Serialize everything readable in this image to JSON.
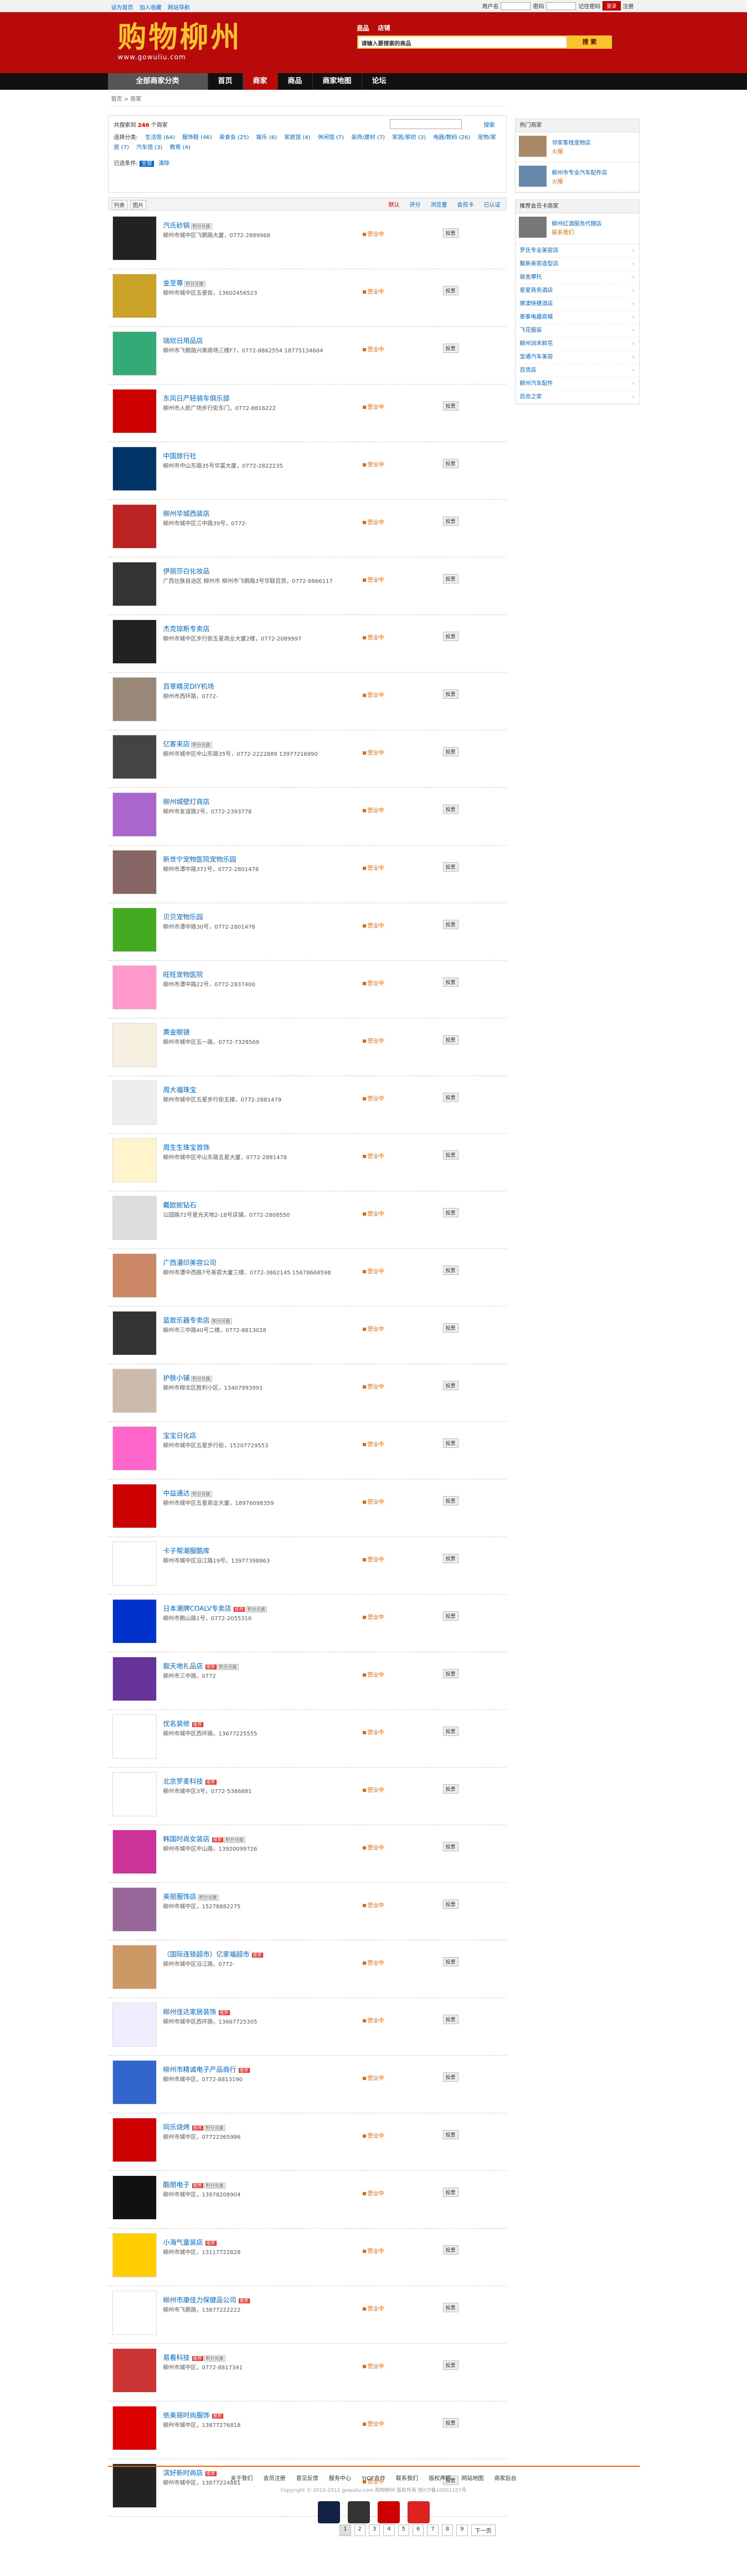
{
  "topbar": {
    "links": [
      "设为首页",
      "加入收藏",
      "网站导航"
    ],
    "user": "用户名",
    "pass": "密码",
    "remember": "记住密码",
    "login": "登录",
    "register": "注册"
  },
  "header": {
    "logo": "购物柳州",
    "url": "www.gowuliu.com",
    "tabs": [
      "商品",
      "店铺"
    ],
    "placeholder": "请输入要搜索的商品",
    "search_btn": "搜 索"
  },
  "nav": {
    "category": "全部商家分类",
    "items": [
      "首页",
      "商家",
      "商品",
      "商家地图",
      "论坛"
    ]
  },
  "crumb": "首页 > 商家",
  "filter": {
    "count_pre": "共搜索到",
    "count": "246",
    "count_post": "个商家",
    "search_btn": "搜索",
    "cat_label": "选择分类:",
    "cats": [
      "生活馆 (64)",
      "服饰鞋 (46)",
      "美食会 (25)",
      "娱乐 (6)",
      "家居馆 (4)",
      "休闲馆 (7)",
      "装饰/建材 (7)",
      "家居/家纺 (3)",
      "电器/数码 (26)",
      "宠物/家居 (7)",
      "汽车馆 (3)",
      "教育 (4)"
    ],
    "sel_label": "已选条件:",
    "sel": "全部",
    "clear": "清除"
  },
  "sortbar": {
    "views": [
      "列表",
      "图片"
    ],
    "sorts": [
      "默认",
      "评分",
      "浏览量",
      "会员卡",
      "已认证"
    ]
  },
  "shops": [
    {
      "name": "汽氏砂锅",
      "addr": "柳州市城中区飞鹅路大厦，0772-2889968",
      "pic": "#222",
      "ok": "营业中",
      "vote": "投票",
      "badge": "",
      "b2": "积分兑换"
    },
    {
      "name": "金至尊",
      "addr": "柳州市城中区五星街，13602456523",
      "pic": "#c9a227",
      "ok": "营业中",
      "vote": "投票",
      "badge": "",
      "b2": "积分兑换"
    },
    {
      "name": "瑞欣日用品店",
      "addr": "柳州市飞鹅路兴南商场三楼F7，0772-8862554 18775134604",
      "pic": "#3a7",
      "ok": "营业中",
      "vote": "投票",
      "badge": "",
      "b2": ""
    },
    {
      "name": "东风日产轻骑车俱乐部",
      "addr": "柳州市人民广场步行街东门，0772-8816222",
      "pic": "#c00",
      "ok": "营业中",
      "vote": "投票",
      "badge": "",
      "b2": ""
    },
    {
      "name": "中国旅行社",
      "addr": "柳州市中山东路35号华富大厦，0772-2822235",
      "pic": "#036",
      "ok": "营业中",
      "vote": "投票",
      "badge": "",
      "b2": ""
    },
    {
      "name": "柳州华城西装店",
      "addr": "柳州市城中区三中路39号，0772-",
      "pic": "#b22",
      "ok": "营业中",
      "vote": "投票",
      "badge": "",
      "b2": ""
    },
    {
      "name": "伊丽莎白化妆品",
      "addr": "广西壮族自治区 柳州市 柳州市飞鹅路3号华联百货，0772-8866117",
      "pic": "#333",
      "ok": "营业中",
      "vote": "投票",
      "badge": "",
      "b2": ""
    },
    {
      "name": "杰克琼斯专卖店",
      "addr": "柳州市城中区步行街五星商业大厦2楼，0772-2089997",
      "pic": "#222",
      "ok": "营业中",
      "vote": "投票",
      "badge": "",
      "b2": ""
    },
    {
      "name": "百草精灵DIY机场",
      "addr": "柳州市西环路，0772-",
      "pic": "#987",
      "ok": "营业中",
      "vote": "投票",
      "badge": "",
      "b2": ""
    },
    {
      "name": "亿客来店",
      "addr": "柳州市城中区中山东路35号，0772-2222889 13977216990",
      "pic": "#444",
      "ok": "营业中",
      "vote": "投票",
      "badge": "",
      "b2": "积分兑换"
    },
    {
      "name": "柳州城壁灯商店",
      "addr": "柳州市友谊路2号，0772-2393778",
      "pic": "#a6c",
      "ok": "营业中",
      "vote": "投票",
      "badge": "",
      "b2": ""
    },
    {
      "name": "新世宁宠物医院宠物乐园",
      "addr": "柳州市潭中路371号，0772-2801478",
      "pic": "#866",
      "ok": "营业中",
      "vote": "投票",
      "badge": "",
      "b2": ""
    },
    {
      "name": "贝贝宠物乐园",
      "addr": "柳州市潭中路30号，0772-2801478",
      "pic": "#4a2",
      "ok": "营业中",
      "vote": "投票",
      "badge": "",
      "b2": ""
    },
    {
      "name": "旺旺宠物医院",
      "addr": "柳州市潭中路22号，0772-2837400",
      "pic": "#f9c",
      "ok": "营业中",
      "vote": "投票",
      "badge": "",
      "b2": ""
    },
    {
      "name": "黄金眼镜",
      "addr": "柳州市城中区五一路，0772-7328569",
      "pic": "#f5f0e0",
      "ok": "营业中",
      "vote": "投票",
      "badge": "",
      "b2": ""
    },
    {
      "name": "周大福珠宝",
      "addr": "柳州市城中区五星步行街五楼，0772-2881479",
      "pic": "#eee",
      "ok": "营业中",
      "vote": "投票",
      "badge": "",
      "b2": ""
    },
    {
      "name": "周生生珠宝首饰",
      "addr": "柳州市城中区中山东路五星大厦，0772-2881478",
      "pic": "#fff4cc",
      "ok": "营业中",
      "vote": "投票",
      "badge": "",
      "b2": ""
    },
    {
      "name": "戴欧妮钻石",
      "addr": "公园路72号星光天地2-18号店铺，0772-2808550",
      "pic": "#ddd",
      "ok": "营业中",
      "vote": "投票",
      "badge": "",
      "b2": ""
    },
    {
      "name": "广西漫印美容公司",
      "addr": "柳州市潭中西路7号美容大厦三楼，0772-3862145 15678668598",
      "pic": "#c86",
      "ok": "营业中",
      "vote": "投票",
      "badge": "",
      "b2": ""
    },
    {
      "name": "蓝歌乐器专卖店",
      "addr": "柳州市三中路40号二楼，0772-8813028",
      "pic": "#333",
      "ok": "营业中",
      "vote": "投票",
      "badge": "",
      "b2": "积分兑换"
    },
    {
      "name": "护肤小铺",
      "addr": "柳州市柳北区胜利小区，13407993991",
      "pic": "#cba",
      "ok": "营业中",
      "vote": "投票",
      "badge": "",
      "b2": "积分兑换"
    },
    {
      "name": "宝宝日化店",
      "addr": "柳州市城中区五星步行街，15207729553",
      "pic": "#f6c",
      "ok": "营业中",
      "vote": "投票",
      "badge": "",
      "b2": ""
    },
    {
      "name": "中益通达",
      "addr": "柳州市城中区五星商业大厦，18976098359",
      "pic": "#c00",
      "ok": "营业中",
      "vote": "投票",
      "badge": "",
      "b2": "积分兑换"
    },
    {
      "name": "卡子帮潮服酷库",
      "addr": "柳州市城中区沿江路19号，13977398863",
      "pic": "#fff",
      "ok": "营业中",
      "vote": "投票",
      "badge": "",
      "b2": ""
    },
    {
      "name": "日本潮牌COALV专卖店",
      "addr": "柳州市鹅山路1号，0772-2055316",
      "pic": "#03c",
      "ok": "营业中",
      "vote": "投票",
      "badge": "推荐",
      "b2": "积分兑换"
    },
    {
      "name": "靓天地礼品店",
      "addr": "柳州市三中路，0772",
      "pic": "#639",
      "ok": "营业中",
      "vote": "投票",
      "badge": "推荐",
      "b2": "积分兑换"
    },
    {
      "name": "优名装修",
      "addr": "柳州市城中区西环路，13677225555",
      "pic": "#fff",
      "ok": "营业中",
      "vote": "投票",
      "badge": "推荐",
      "b2": ""
    },
    {
      "name": "北京罗麦科技",
      "addr": "柳州市城中区3号，0772-5386881",
      "pic": "#fff",
      "ok": "营业中",
      "vote": "投票",
      "badge": "推荐",
      "b2": ""
    },
    {
      "name": "韩国时尚女装店",
      "addr": "柳州市城中区中山路，13920099726",
      "pic": "#c39",
      "ok": "营业中",
      "vote": "投票",
      "badge": "推荐",
      "b2": "积分兑换"
    },
    {
      "name": "美丽服饰店",
      "addr": "柳州市城中区，15278882275",
      "pic": "#969",
      "ok": "营业中",
      "vote": "投票",
      "badge": "",
      "b2": "积分兑换"
    },
    {
      "name": "（国际连锁超市）亿家福超市",
      "addr": "柳州市城中区沿江路，0772-",
      "pic": "#c96",
      "ok": "营业中",
      "vote": "投票",
      "badge": "推荐",
      "b2": ""
    },
    {
      "name": "柳州佳达家居装饰",
      "addr": "柳州市城中区西环路，13667725305",
      "pic": "#eef",
      "ok": "营业中",
      "vote": "投票",
      "badge": "推荐",
      "b2": ""
    },
    {
      "name": "柳州市精诚电子产品商行",
      "addr": "柳州市城中区，0772-8813190",
      "pic": "#36c",
      "ok": "营业中",
      "vote": "投票",
      "badge": "推荐",
      "b2": ""
    },
    {
      "name": "同乐烧烤",
      "addr": "柳州市城中区，07722365986",
      "pic": "#c00",
      "ok": "营业中",
      "vote": "投票",
      "badge": "推荐",
      "b2": "积分兑换"
    },
    {
      "name": "酷朋电子",
      "addr": "柳州市城中区，13978208904",
      "pic": "#111",
      "ok": "营业中",
      "vote": "投票",
      "badge": "推荐",
      "b2": "积分兑换"
    },
    {
      "name": "小海气童装店",
      "addr": "柳州市城中区，13117722828",
      "pic": "#fc0",
      "ok": "营业中",
      "vote": "投票",
      "badge": "推荐",
      "b2": ""
    },
    {
      "name": "柳州市康佳力保健品公司",
      "addr": "柳州市飞鹅路，13877222222",
      "pic": "#fff",
      "ok": "营业中",
      "vote": "投票",
      "badge": "推荐",
      "b2": ""
    },
    {
      "name": "易看科技",
      "addr": "柳州市城中区，0772-8817341",
      "pic": "#c33",
      "ok": "营业中",
      "vote": "投票",
      "badge": "推荐",
      "b2": "积分兑换"
    },
    {
      "name": "依美丽时尚服饰",
      "addr": "柳州市城中区，13877276818",
      "pic": "#d00",
      "ok": "营业中",
      "vote": "投票",
      "badge": "推荐",
      "b2": ""
    },
    {
      "name": "滨好新时尚店",
      "addr": "柳州市城中区，13877224881",
      "pic": "#222",
      "ok": "营业中",
      "vote": "投票",
      "badge": "推荐",
      "b2": ""
    }
  ],
  "pager": [
    "1",
    "2",
    "3",
    "4",
    "5",
    "6",
    "7",
    "8",
    "9",
    "下一页"
  ],
  "side": {
    "recent_title": "热门商家",
    "recent": [
      {
        "name": "邻家客栈宠物店",
        "s": "火爆"
      },
      {
        "name": "柳州市专业汽车配件店",
        "s": "火爆"
      }
    ],
    "hot_title": "推荐会员卡商家",
    "hot": [
      {
        "name": "柳州红酒服务代理店",
        "s": "联系我们"
      }
    ],
    "list": [
      "罗氏专业美容店",
      "飘新美容造型店",
      "骏金摩托",
      "星星商务酒店",
      "摩澳快捷酒店",
      "豪泰电器商城",
      "飞花服装",
      "柳州润禾鲜花",
      "宝通汽车美容",
      "百货店",
      "柳州汽车配件",
      "百合之家"
    ]
  },
  "footer": {
    "links": [
      "关于我们",
      "会员注册",
      "意见反馈",
      "服务中心",
      "YIOF合作",
      "联系我们",
      "版权声明",
      "网站地图",
      "商家后台"
    ],
    "copy": "Copyright © 2010-2011 gowuliu.com 购物柳州 版权所有 桂ICP备10001157号"
  }
}
